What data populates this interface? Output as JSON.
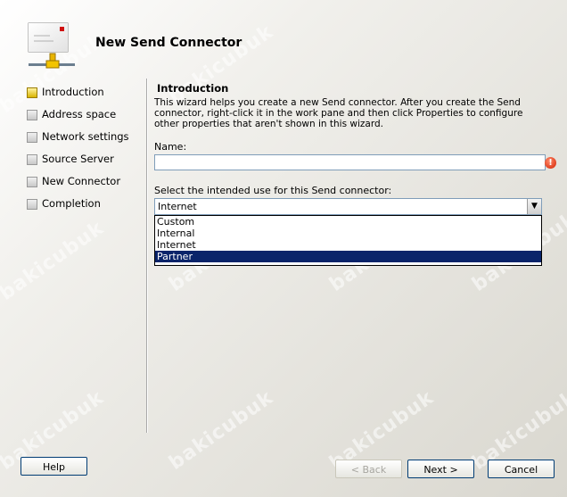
{
  "wizard": {
    "title": "New Send Connector"
  },
  "nav": {
    "items": [
      {
        "label": "Introduction",
        "active": true
      },
      {
        "label": "Address space",
        "active": false
      },
      {
        "label": "Network settings",
        "active": false
      },
      {
        "label": "Source Server",
        "active": false
      },
      {
        "label": "New Connector",
        "active": false
      },
      {
        "label": "Completion",
        "active": false
      }
    ]
  },
  "content": {
    "section_title": "Introduction",
    "intro_text": "This wizard helps you create a new Send connector. After you create the Send connector, right-click it in the work pane and then click Properties to configure other properties that aren't shown in this wizard.",
    "name_label": "Name:",
    "name_value": "",
    "use_label": "Select the intended use for this Send connector:",
    "use_selected": "Internet",
    "use_options": [
      "Custom",
      "Internal",
      "Internet",
      "Partner"
    ],
    "highlighted_option": "Partner"
  },
  "buttons": {
    "help": "Help",
    "back": "< Back",
    "next": "Next >",
    "cancel": "Cancel"
  },
  "colors": {
    "selection": "#0a246a",
    "error": "#d42000",
    "active_bullet": "#d9b400"
  },
  "watermark_text": "bakicubuk"
}
